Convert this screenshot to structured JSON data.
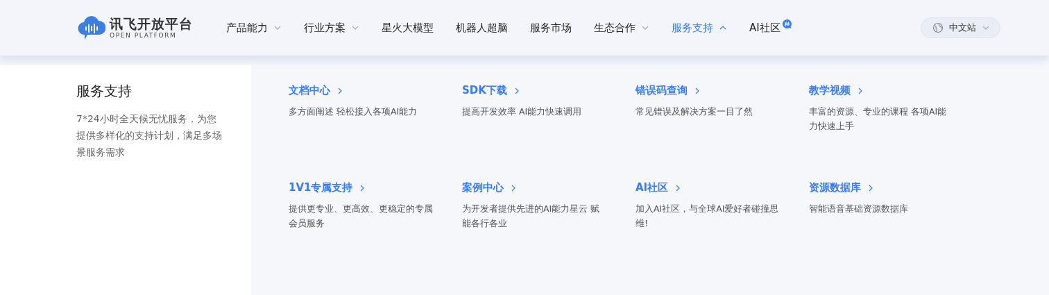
{
  "logo": {
    "title": "讯飞开放平台",
    "subtitle": "OPEN PLATFORM"
  },
  "nav": [
    {
      "label": "产品能力",
      "kind": "dropdown",
      "selected": false,
      "expanded": false
    },
    {
      "label": "行业方案",
      "kind": "dropdown",
      "selected": false,
      "expanded": false
    },
    {
      "label": "星火大模型",
      "kind": "link",
      "selected": false
    },
    {
      "label": "机器人超脑",
      "kind": "link",
      "selected": false
    },
    {
      "label": "服务市场",
      "kind": "link",
      "selected": false
    },
    {
      "label": "生态合作",
      "kind": "dropdown",
      "selected": false,
      "expanded": false
    },
    {
      "label": "服务支持",
      "kind": "dropdown",
      "selected": true,
      "expanded": true
    },
    {
      "label": "AI社区",
      "kind": "badged",
      "selected": false
    }
  ],
  "site_switch": {
    "label": "中文站"
  },
  "panel": {
    "title": "服务支持",
    "description": "7*24小时全天候无忧服务，为您提供多样化的支持计划，满足多场景服务需求"
  },
  "links": [
    {
      "title": "文档中心",
      "description": "多方面阐述 轻松接入各项AI能力"
    },
    {
      "title": "SDK下载",
      "description": "提高开发效率 AI能力快速调用"
    },
    {
      "title": "错误码查询",
      "description": "常见错误及解决方案一目了然"
    },
    {
      "title": "教学视频",
      "description": "丰富的资源、专业的课程 各项AI能力快速上手"
    },
    {
      "title": "1V1专属支持",
      "description": "提供更专业、更高效、更稳定的专属会员服务"
    },
    {
      "title": "案例中心",
      "description": "为开发者提供先进的AI能力星云 赋能各行各业"
    },
    {
      "title": "AI社区",
      "description": "加入AI社区，与全球AI爱好者碰撞思维!"
    },
    {
      "title": "资源数据库",
      "description": "智能语音基础资源数据库"
    }
  ]
}
